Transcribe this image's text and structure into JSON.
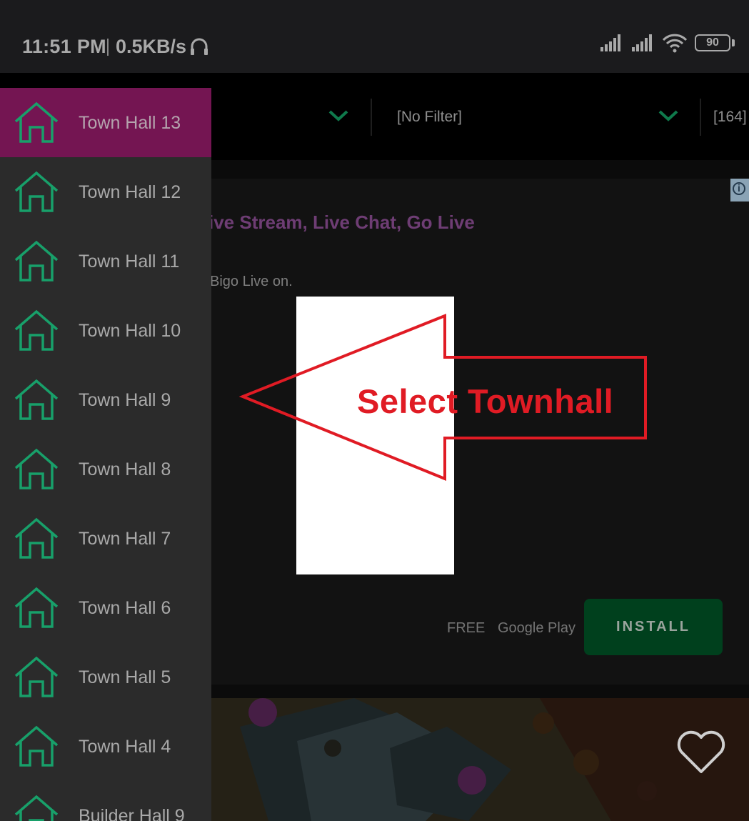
{
  "status_bar": {
    "time": "11:51 PM",
    "net_speed": "0.5KB/s",
    "battery": "90",
    "icons": [
      "headset-icon",
      "signal-icon",
      "signal-icon",
      "wifi-icon",
      "battery-icon"
    ]
  },
  "toolbar": {
    "filter_label": "[No Filter]",
    "count": "[164]"
  },
  "ad": {
    "title": "ive Stream, Live Chat, Go Live",
    "description": "Bigo Live on.",
    "price": "FREE",
    "store": "Google Play",
    "install_label": "INSTALL"
  },
  "annotation": {
    "text": "Select Townhall",
    "color": "#e01b24"
  },
  "drawer": {
    "active_color": "#741552",
    "icon_color": "#18a06a",
    "items": [
      {
        "label": "Town Hall 13"
      },
      {
        "label": "Town Hall 12"
      },
      {
        "label": "Town Hall 11"
      },
      {
        "label": "Town Hall 10"
      },
      {
        "label": "Town Hall 9"
      },
      {
        "label": "Town Hall 8"
      },
      {
        "label": "Town Hall 7"
      },
      {
        "label": "Town Hall 6"
      },
      {
        "label": "Town Hall 5"
      },
      {
        "label": "Town Hall 4"
      },
      {
        "label": "Builder Hall 9"
      }
    ]
  }
}
